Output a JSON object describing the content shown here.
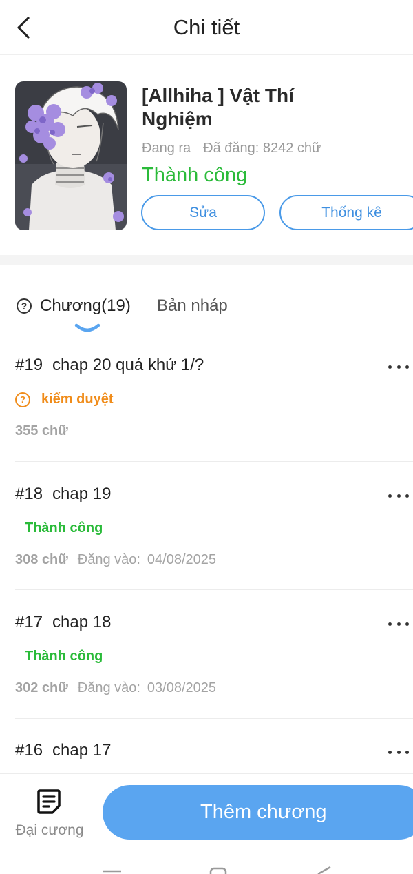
{
  "header": {
    "title": "Chi tiết"
  },
  "book": {
    "title": "[Allhiha ] Vật Thí Nghiệm",
    "state": "Đang ra",
    "published_words": "Đã đăng: 8242 chữ",
    "status": "Thành công",
    "edit_label": "Sửa",
    "stats_label": "Thống kê"
  },
  "tabs": [
    {
      "label": "Chương(19)",
      "icon": "help-circle-icon",
      "active": true
    },
    {
      "label": "Bản nháp",
      "active": false
    }
  ],
  "chapters": [
    {
      "num": "#19",
      "title": "chap 20 quá khứ 1/?",
      "status": "kiểm duyệt",
      "status_type": "pending",
      "words": "355 chữ",
      "posted_label": "",
      "date": ""
    },
    {
      "num": "#18",
      "title": "chap 19",
      "status": "Thành công",
      "status_type": "success",
      "words": "308 chữ",
      "posted_label": "Đăng vào:",
      "date": "04/08/2025"
    },
    {
      "num": "#17",
      "title": "chap 18",
      "status": "Thành công",
      "status_type": "success",
      "words": "302 chữ",
      "posted_label": "Đăng vào:",
      "date": "03/08/2025"
    },
    {
      "num": "#16",
      "title": "chap 17"
    }
  ],
  "bottom": {
    "outline_label": "Đại cương",
    "add_chapter_label": "Thêm chương"
  },
  "colors": {
    "accent": "#5aa5f0",
    "success": "#2bbb3a",
    "pending": "#f08c1a"
  }
}
